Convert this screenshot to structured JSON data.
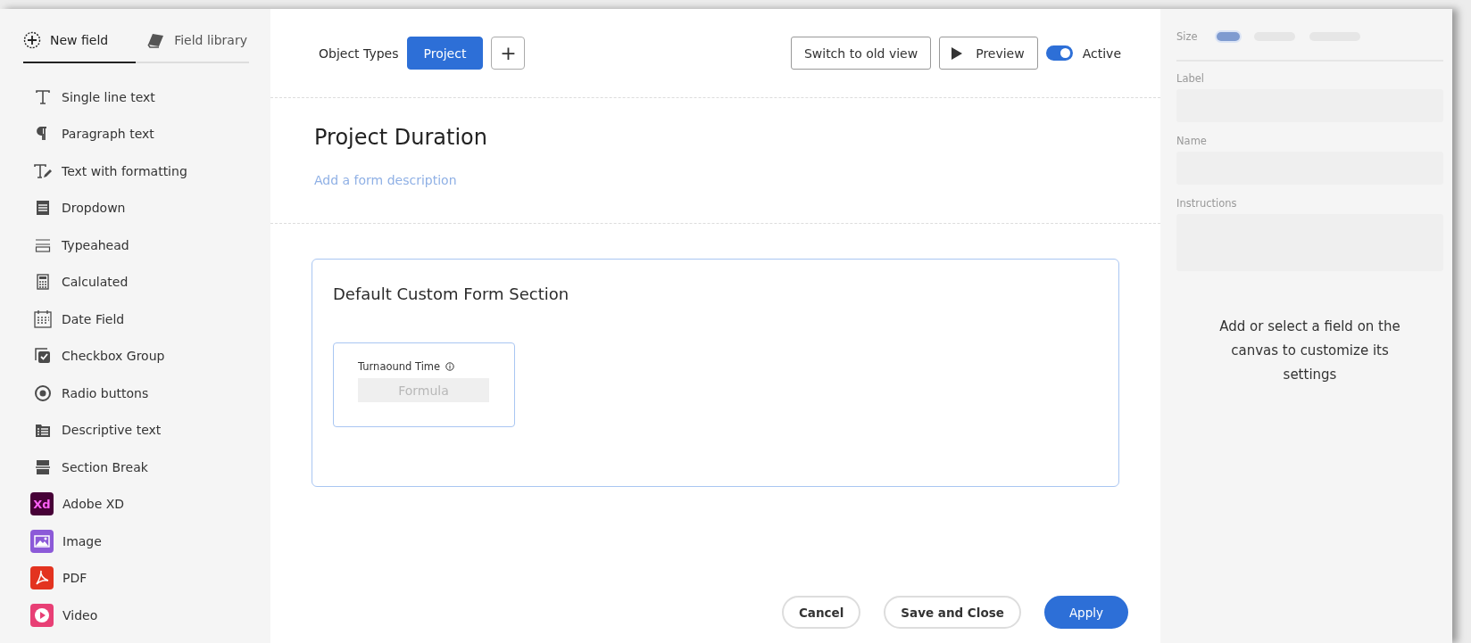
{
  "sidebar": {
    "tabs": [
      {
        "label": "New field",
        "kind": "new",
        "selected": true
      },
      {
        "label": "Field library",
        "kind": "library",
        "selected": false
      }
    ],
    "items": [
      {
        "label": "Single line text",
        "kind": "single"
      },
      {
        "label": "Paragraph text",
        "kind": "paragraph"
      },
      {
        "label": "Text with formatting",
        "kind": "formatting"
      },
      {
        "label": "Dropdown",
        "kind": "dropdown"
      },
      {
        "label": "Typeahead",
        "kind": "typeahead"
      },
      {
        "label": "Calculated",
        "kind": "calculated"
      },
      {
        "label": "Date Field",
        "kind": "date"
      },
      {
        "label": "Checkbox Group",
        "kind": "checkbox"
      },
      {
        "label": "Radio buttons",
        "kind": "radio"
      },
      {
        "label": "Descriptive text",
        "kind": "descriptive"
      },
      {
        "label": "Section Break",
        "kind": "section"
      },
      {
        "label": "Adobe XD",
        "kind": "xd",
        "badge": "Xd"
      },
      {
        "label": "Image",
        "kind": "image"
      },
      {
        "label": "PDF",
        "kind": "pdf"
      },
      {
        "label": "Video",
        "kind": "video"
      }
    ]
  },
  "toolbar": {
    "object_types_label": "Object Types",
    "object_types": [
      {
        "label": "Project",
        "selected": true
      }
    ],
    "add_button": "+",
    "switch_button": "Switch to old view",
    "preview_button": "Preview",
    "active_toggle": {
      "label": "Active",
      "on": true
    }
  },
  "form": {
    "title": "Project Duration",
    "description_placeholder": "Add a form description",
    "sections": [
      {
        "title": "Default Custom Form Section",
        "fields": [
          {
            "label": "Turnaound Time",
            "value": "Formula"
          }
        ]
      }
    ]
  },
  "footer": {
    "buttons": [
      {
        "label": "Cancel",
        "kind": "secondary"
      },
      {
        "label": "Save and Close",
        "kind": "secondary"
      },
      {
        "label": "Apply",
        "kind": "primary"
      }
    ]
  },
  "settings": {
    "size_label": "Size",
    "size_options": [
      {
        "selected": true
      },
      {
        "selected": false
      },
      {
        "selected": false
      }
    ],
    "fields": [
      {
        "label": "Label",
        "kind": "short"
      },
      {
        "label": "Name",
        "kind": "short"
      },
      {
        "label": "Instructions",
        "kind": "tall"
      }
    ],
    "message": "Add or select a field on the canvas to customize its settings"
  }
}
